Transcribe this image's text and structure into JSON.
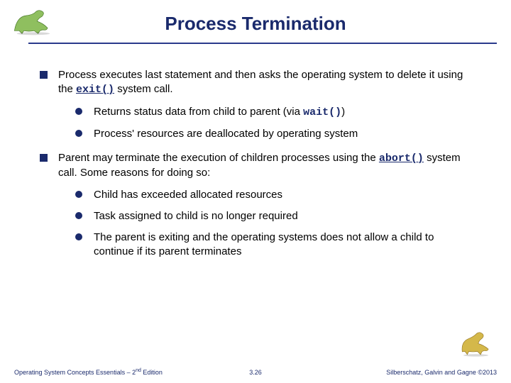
{
  "title": "Process Termination",
  "b1": {
    "pre": "Process executes last statement and then asks the operating system to delete it using the ",
    "code": "exit()",
    "post": " system call.",
    "s1": {
      "pre": "Returns  status data from child to parent (via ",
      "code": "wait()",
      "post": ")"
    },
    "s2": "Process' resources are deallocated by operating system"
  },
  "b2": {
    "pre": "Parent may terminate the execution of children processes using the ",
    "code": "abort()",
    "post": " system call.  Some reasons for doing so:",
    "s1": "Child has exceeded allocated resources",
    "s2": "Task assigned to child is no longer required",
    "s3": "The parent is exiting and the operating systems does not allow  a child to continue if its parent terminates"
  },
  "footer": {
    "left_pre": "Operating System Concepts Essentials – 2",
    "left_sup": "nd",
    "left_post": " Edition",
    "center": "3.26",
    "right": "Silberschatz, Galvin and Gagne ©2013"
  }
}
